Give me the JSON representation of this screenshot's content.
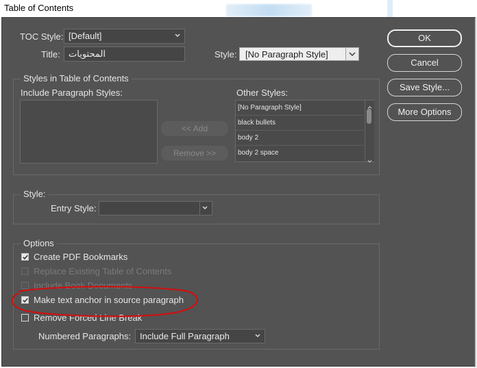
{
  "window": {
    "title": "Table of Contents"
  },
  "toc": {
    "toc_style_label": "TOC Style:",
    "toc_style_value": "[Default]",
    "title_label": "Title:",
    "title_value": "المحتويات",
    "style_label": "Style:",
    "style_value": "[No Paragraph Style]"
  },
  "buttons": {
    "ok": "OK",
    "cancel": "Cancel",
    "save_style": "Save Style...",
    "more_options": "More Options",
    "add": "<< Add",
    "remove": "Remove >>"
  },
  "styles_section": {
    "title": "Styles in Table of Contents",
    "include_label": "Include Paragraph Styles:",
    "other_label": "Other Styles:",
    "other_styles": [
      "[No Paragraph Style]",
      "black bullets",
      "body 2",
      "body 2 space"
    ]
  },
  "style_section": {
    "title": "Style:",
    "entry_style_label": "Entry Style:",
    "entry_style_value": ""
  },
  "options": {
    "title": "Options",
    "items": [
      {
        "label": "Create PDF Bookmarks",
        "checked": true,
        "enabled": true
      },
      {
        "label": "Replace Existing Table of Contents",
        "checked": false,
        "enabled": false
      },
      {
        "label": "Include Book Documents",
        "checked": false,
        "enabled": false
      },
      {
        "label": "Make text anchor in source paragraph",
        "checked": true,
        "enabled": true
      },
      {
        "label": "Remove Forced Line Break",
        "checked": false,
        "enabled": true
      }
    ],
    "numbered_label": "Numbered Paragraphs:",
    "numbered_value": "Include Full Paragraph"
  },
  "colors": {
    "dialog_bg": "#535353",
    "annotation": "#d01010"
  },
  "icons": [
    "chevron-down-icon",
    "checkmark-icon"
  ]
}
